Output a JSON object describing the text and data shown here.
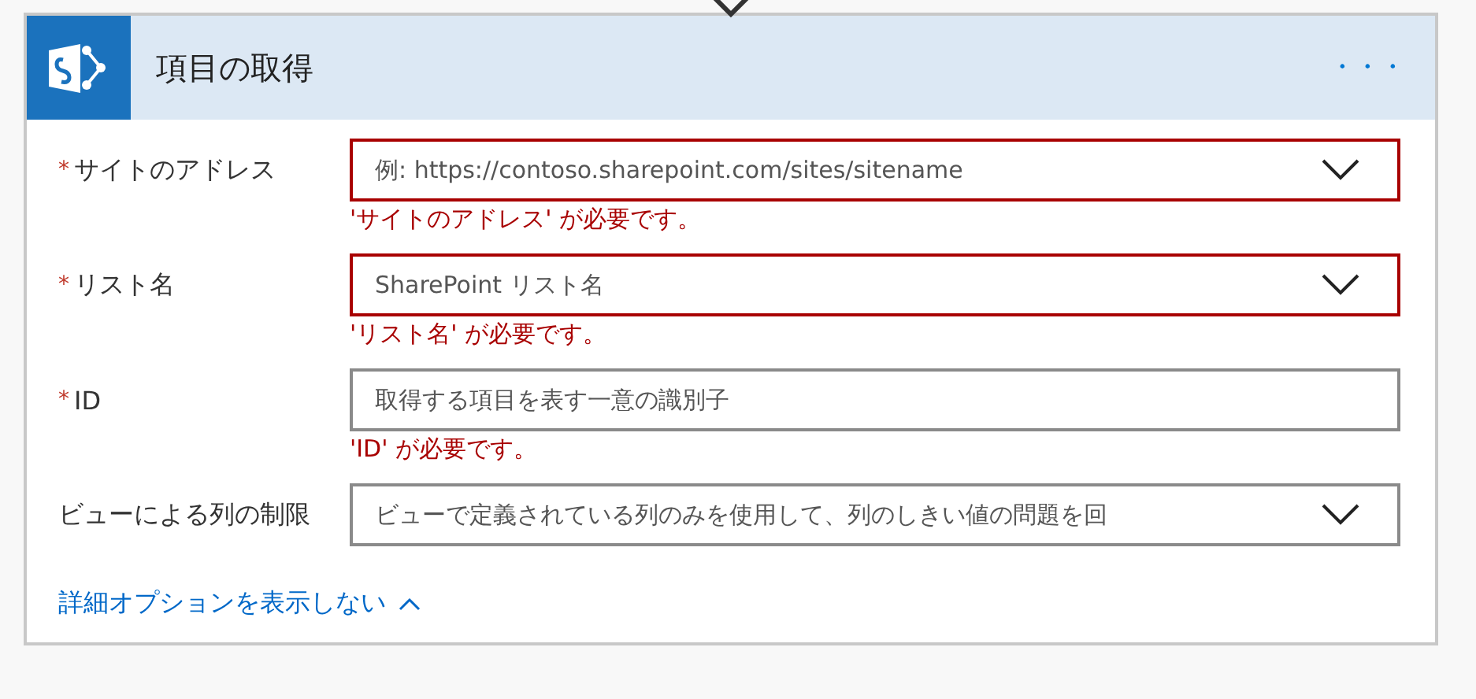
{
  "card": {
    "title": "項目の取得",
    "more": "・・・",
    "fields": [
      {
        "label": "サイトのアドレス",
        "required_mark": "*",
        "kind": "dropdown",
        "placeholder": "例: https://contoso.sharepoint.com/sites/sitename",
        "invalid": true,
        "error": "'サイトのアドレス' が必要です。"
      },
      {
        "label": "リスト名",
        "required_mark": "*",
        "kind": "dropdown",
        "placeholder": "SharePoint リスト名",
        "invalid": true,
        "error": "'リスト名' が必要です。"
      },
      {
        "label": "ID",
        "required_mark": "*",
        "kind": "text",
        "placeholder": "取得する項目を表す一意の識別子",
        "invalid": false,
        "error": "'ID' が必要です。"
      },
      {
        "label": "ビューによる列の制限",
        "kind": "dropdown",
        "placeholder": "ビューで定義されている列のみを使用して、列のしきい値の問題を回",
        "invalid": false
      }
    ],
    "advanced_link": {
      "label": "詳細オプションを表示しない",
      "expanded": true
    }
  }
}
